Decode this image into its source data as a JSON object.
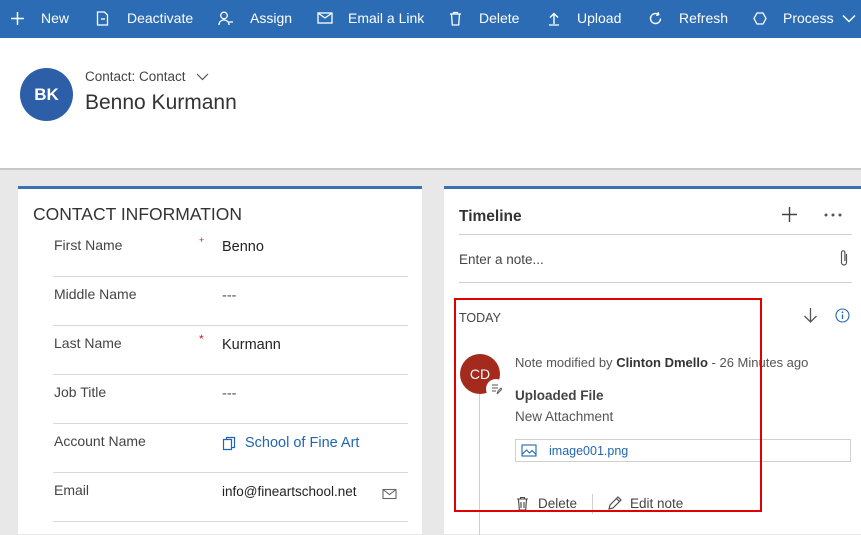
{
  "command_bar": {
    "new": "New",
    "deactivate": "Deactivate",
    "assign": "Assign",
    "email_link": "Email a Link",
    "delete": "Delete",
    "upload": "Upload",
    "refresh": "Refresh",
    "process": "Process"
  },
  "header": {
    "initials": "BK",
    "entity_type": "Contact: Contact",
    "name": "Benno Kurmann"
  },
  "contact_info": {
    "title": "CONTACT INFORMATION",
    "fields": [
      {
        "label": "First Name",
        "value": "Benno",
        "required": "+"
      },
      {
        "label": "Middle Name",
        "value": "---"
      },
      {
        "label": "Last Name",
        "value": "Kurmann",
        "required": "*"
      },
      {
        "label": "Job Title",
        "value": "---"
      },
      {
        "label": "Account Name",
        "value": "School of Fine Art"
      },
      {
        "label": "Email",
        "value": "info@fineartschool.net"
      }
    ]
  },
  "timeline": {
    "title": "Timeline",
    "note_placeholder": "Enter a note...",
    "group": "TODAY",
    "entry": {
      "initials": "CD",
      "prefix": "Note modified by",
      "author": "Clinton Dmello",
      "time": "26 Minutes ago",
      "title": "Uploaded File",
      "description": "New Attachment",
      "attachment": "image001.png",
      "delete_label": "Delete",
      "edit_label": "Edit note"
    }
  },
  "colors": {
    "command_bar": "#2b6cb4",
    "avatar": "#2d5ea8",
    "timeline_avatar": "#a52a1e",
    "link": "#2266b2",
    "highlight": "#e00000"
  }
}
